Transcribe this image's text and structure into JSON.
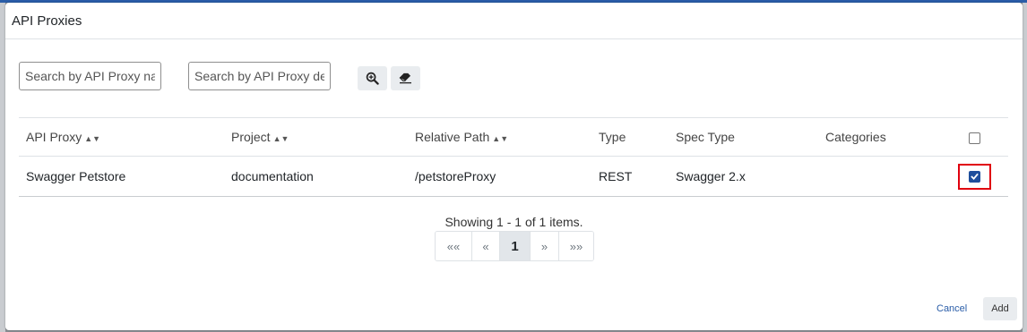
{
  "dialog": {
    "title": "API Proxies"
  },
  "search": {
    "name_placeholder": "Search by API Proxy name",
    "description_placeholder": "Search by API Proxy description"
  },
  "table": {
    "headers": {
      "api_proxy": "API Proxy",
      "project": "Project",
      "relative_path": "Relative Path",
      "type": "Type",
      "spec_type": "Spec Type",
      "categories": "Categories"
    },
    "rows": [
      {
        "api_proxy": "Swagger Petstore",
        "project": "documentation",
        "relative_path": "/petstoreProxy",
        "type": "REST",
        "spec_type": "Swagger 2.x",
        "categories": "",
        "selected": true
      }
    ],
    "select_all_checked": false
  },
  "pagination": {
    "info": "Showing 1 - 1 of 1 items.",
    "first": "««",
    "prev": "«",
    "current": "1",
    "next": "»",
    "last": "»»"
  },
  "footer": {
    "cancel_label": "Cancel",
    "add_label": "Add"
  },
  "icons": {
    "search": "magnifier-plus-icon",
    "clear": "eraser-icon",
    "sort": "sort-icon",
    "check": "check-icon"
  },
  "colors": {
    "accent": "#1e4e9c",
    "highlight": "#e0000f",
    "link": "#2a5da8"
  }
}
